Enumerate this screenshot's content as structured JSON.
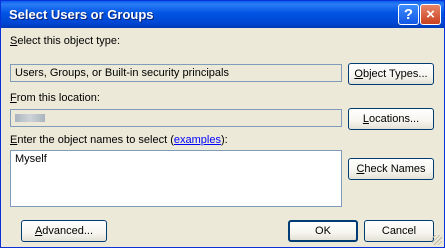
{
  "window": {
    "title": "Select Users or Groups",
    "help_glyph": "?",
    "close_glyph": "×"
  },
  "object_type": {
    "label_u": "S",
    "label_rest": "elect this object type:",
    "value": "Users, Groups, or Built-in security principals",
    "button_u": "O",
    "button_rest": "bject Types..."
  },
  "location": {
    "label_u": "F",
    "label_rest": "rom this location:",
    "value_redacted": true,
    "button_u": "L",
    "button_rest": "ocations..."
  },
  "names": {
    "label_u": "E",
    "label_pre": "nter the object names to select (",
    "label_link": "examples",
    "label_post": "):",
    "value": "Myself",
    "check_u": "C",
    "check_rest": "heck Names"
  },
  "footer": {
    "advanced_u": "A",
    "advanced_rest": "dvanced...",
    "ok": "OK",
    "cancel": "Cancel"
  }
}
